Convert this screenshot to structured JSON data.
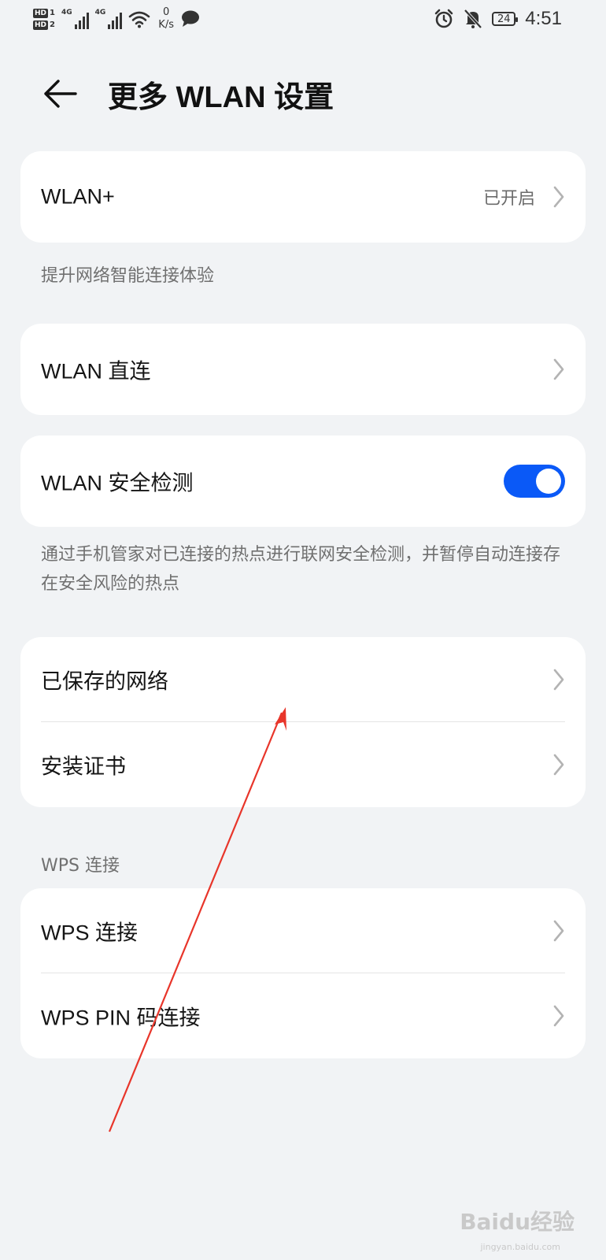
{
  "status_bar": {
    "hd1": "HD",
    "hd1_num": "1",
    "hd2": "HD",
    "hd2_num": "2",
    "sim1_type": "4G",
    "sim2_type": "4G",
    "speed_value": "0",
    "speed_unit": "K/s",
    "battery": "24",
    "time": "4:51",
    "icons": [
      "signal-icon",
      "wifi-icon",
      "message-icon",
      "alarm-icon",
      "mute-icon",
      "battery-icon"
    ]
  },
  "header": {
    "back_icon": "arrow-left-icon",
    "title": "更多 WLAN 设置"
  },
  "wlan_plus": {
    "label": "WLAN+",
    "value": "已开启",
    "note": "提升网络智能连接体验"
  },
  "wlan_direct": {
    "label": "WLAN 直连"
  },
  "security_check": {
    "label": "WLAN 安全检测",
    "enabled": true,
    "toggle_color": "#0a59f7",
    "note": "通过手机管家对已连接的热点进行联网安全检测，并暂停自动连接存在安全风险的热点"
  },
  "network_group": {
    "items": [
      {
        "label": "已保存的网络"
      },
      {
        "label": "安装证书"
      }
    ]
  },
  "wps": {
    "section_title": "WPS 连接",
    "items": [
      {
        "label": "WPS 连接"
      },
      {
        "label": "WPS PIN 码连接"
      }
    ]
  },
  "annotation": {
    "arrow_color": "#e8352a"
  },
  "watermark": {
    "text": "Baidu经验",
    "sub": "jingyan.baidu.com"
  }
}
